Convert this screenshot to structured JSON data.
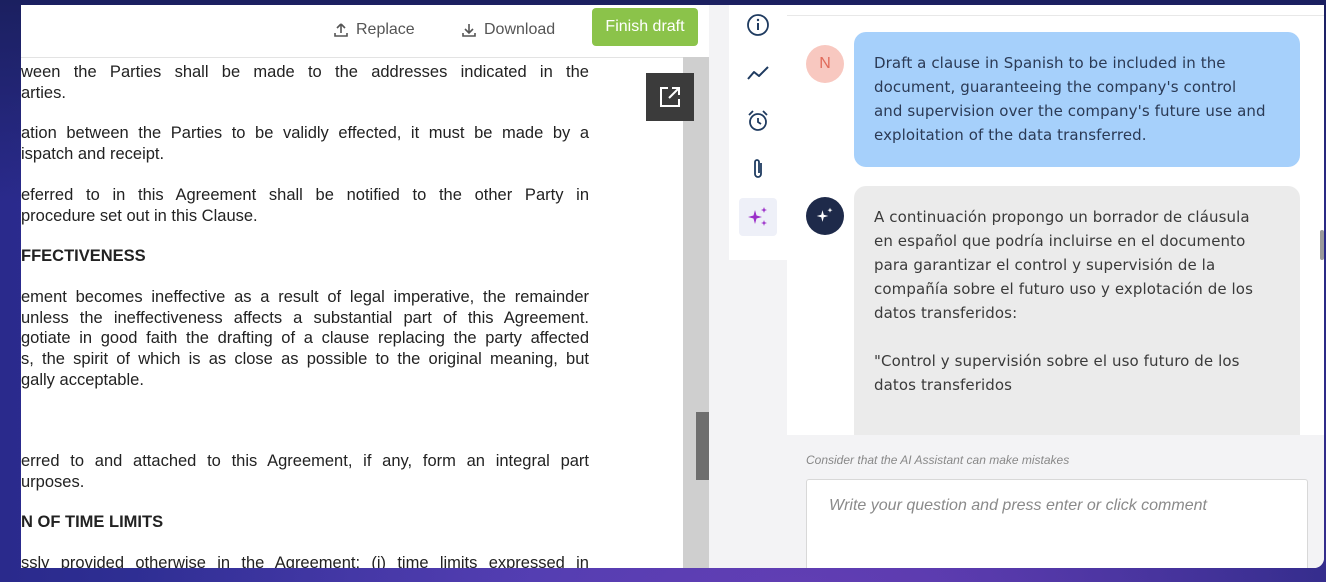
{
  "toolbar": {
    "replace_label": "Replace",
    "download_label": "Download",
    "finish_label": "Finish draft",
    "finish_color": "#8bc34a"
  },
  "document": {
    "lines": [
      "ween the Parties shall be made to the addresses indicated in the",
      "arties.",
      "ation between the Parties to be validly effected, it must be made by a",
      "ispatch and receipt.",
      "eferred to in this Agreement shall be notified to the other Party in",
      "procedure set out in this Clause.",
      "FFECTIVENESS",
      "ement becomes ineffective as a result of legal imperative, the remainder",
      " unless the ineffectiveness affects a substantial part of this Agreement.",
      "gotiate in good faith the drafting of a clause replacing the party affected",
      "s, the spirit of which is as close as possible to the original meaning, but",
      "gally acceptable.",
      "erred to and attached to this Agreement, if any, form an integral part",
      "urposes.",
      "N OF TIME LIMITS",
      "ssly provided otherwise in the Agreement: (i) time limits expressed in"
    ]
  },
  "rail": {
    "icons": [
      "info-icon",
      "trend-icon",
      "alarm-clock-icon",
      "paperclip-icon",
      "ai-sparkle-icon"
    ],
    "active": "ai-sparkle-icon",
    "accent": "#9b2fc9"
  },
  "chat": {
    "user_initial": "N",
    "user_message": [
      "Draft a clause in Spanish to be included in the",
      "document, guaranteeing the company's control",
      "and supervision over the company's future use and",
      "exploitation of the data transferred."
    ],
    "ai_message": [
      "A continuación propongo un borrador de cláusula",
      "en español que podría incluirse en el documento",
      "para garantizar el control y supervisión de la",
      "compañía sobre el futuro uso y explotación de los",
      "datos transferidos:",
      "\"Control y supervisión sobre el uso futuro de los",
      "datos transferidos"
    ]
  },
  "footer": {
    "disclaimer": "Consider that the AI Assistant can make mistakes",
    "input_placeholder": "Write your question and press enter or click comment"
  }
}
